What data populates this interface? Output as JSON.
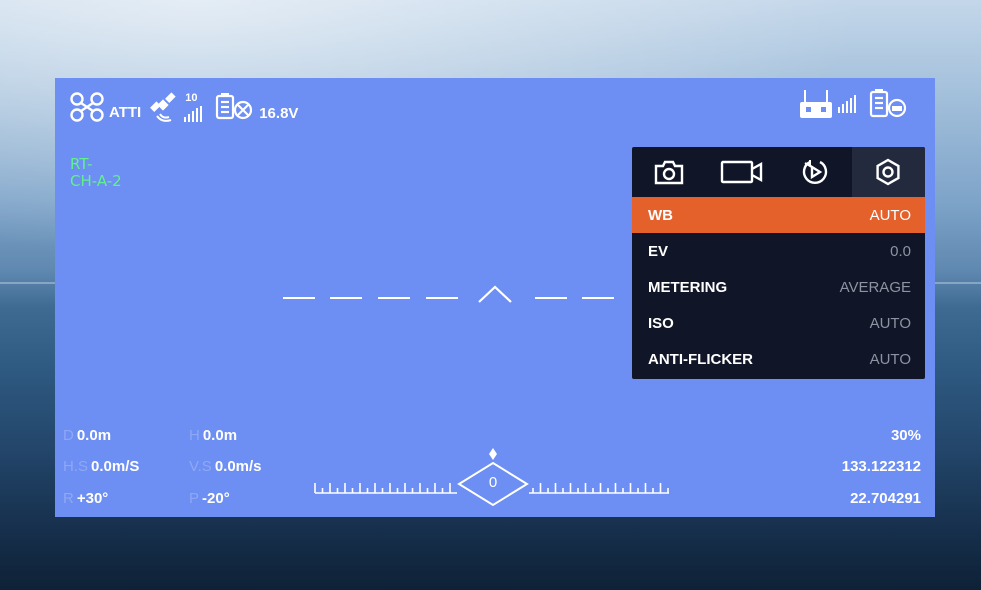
{
  "status": {
    "flight_mode": "ATTI",
    "satellite_count": "10",
    "battery_voltage": "16.8V"
  },
  "aircraft_id": {
    "line1": "RT-",
    "line2": "CH-A-2"
  },
  "telemetry": {
    "d_label": "D",
    "d_value": "0.0m",
    "h_label": "H",
    "h_value": "0.0m",
    "hs_label": "H.S",
    "hs_value": "0.0m/S",
    "vs_label": "V.S",
    "vs_value": "0.0m/s",
    "r_label": "R",
    "r_value": "+30°",
    "p_label": "P",
    "p_value": "-20°"
  },
  "right_info": {
    "percent": "30%",
    "longitude": "133.122312",
    "latitude": "22.704291"
  },
  "heading": {
    "value": "0"
  },
  "settings_panel": {
    "tabs": [
      {
        "icon": "camera-icon",
        "active": false
      },
      {
        "icon": "video-icon",
        "active": false
      },
      {
        "icon": "playback-icon",
        "active": false
      },
      {
        "icon": "gear-icon",
        "active": true
      }
    ],
    "rows": [
      {
        "key": "WB",
        "value": "AUTO",
        "selected": true
      },
      {
        "key": "EV",
        "value": "0.0",
        "selected": false
      },
      {
        "key": "METERING",
        "value": "AVERAGE",
        "selected": false
      },
      {
        "key": "ISO",
        "value": "AUTO",
        "selected": false
      },
      {
        "key": "ANTI-FLICKER",
        "value": "AUTO",
        "selected": false
      }
    ]
  },
  "colors": {
    "hud_background": "#6d8ef2",
    "panel_background": "#101627",
    "selected_row": "#e4612c",
    "id_text": "#61f28b"
  }
}
